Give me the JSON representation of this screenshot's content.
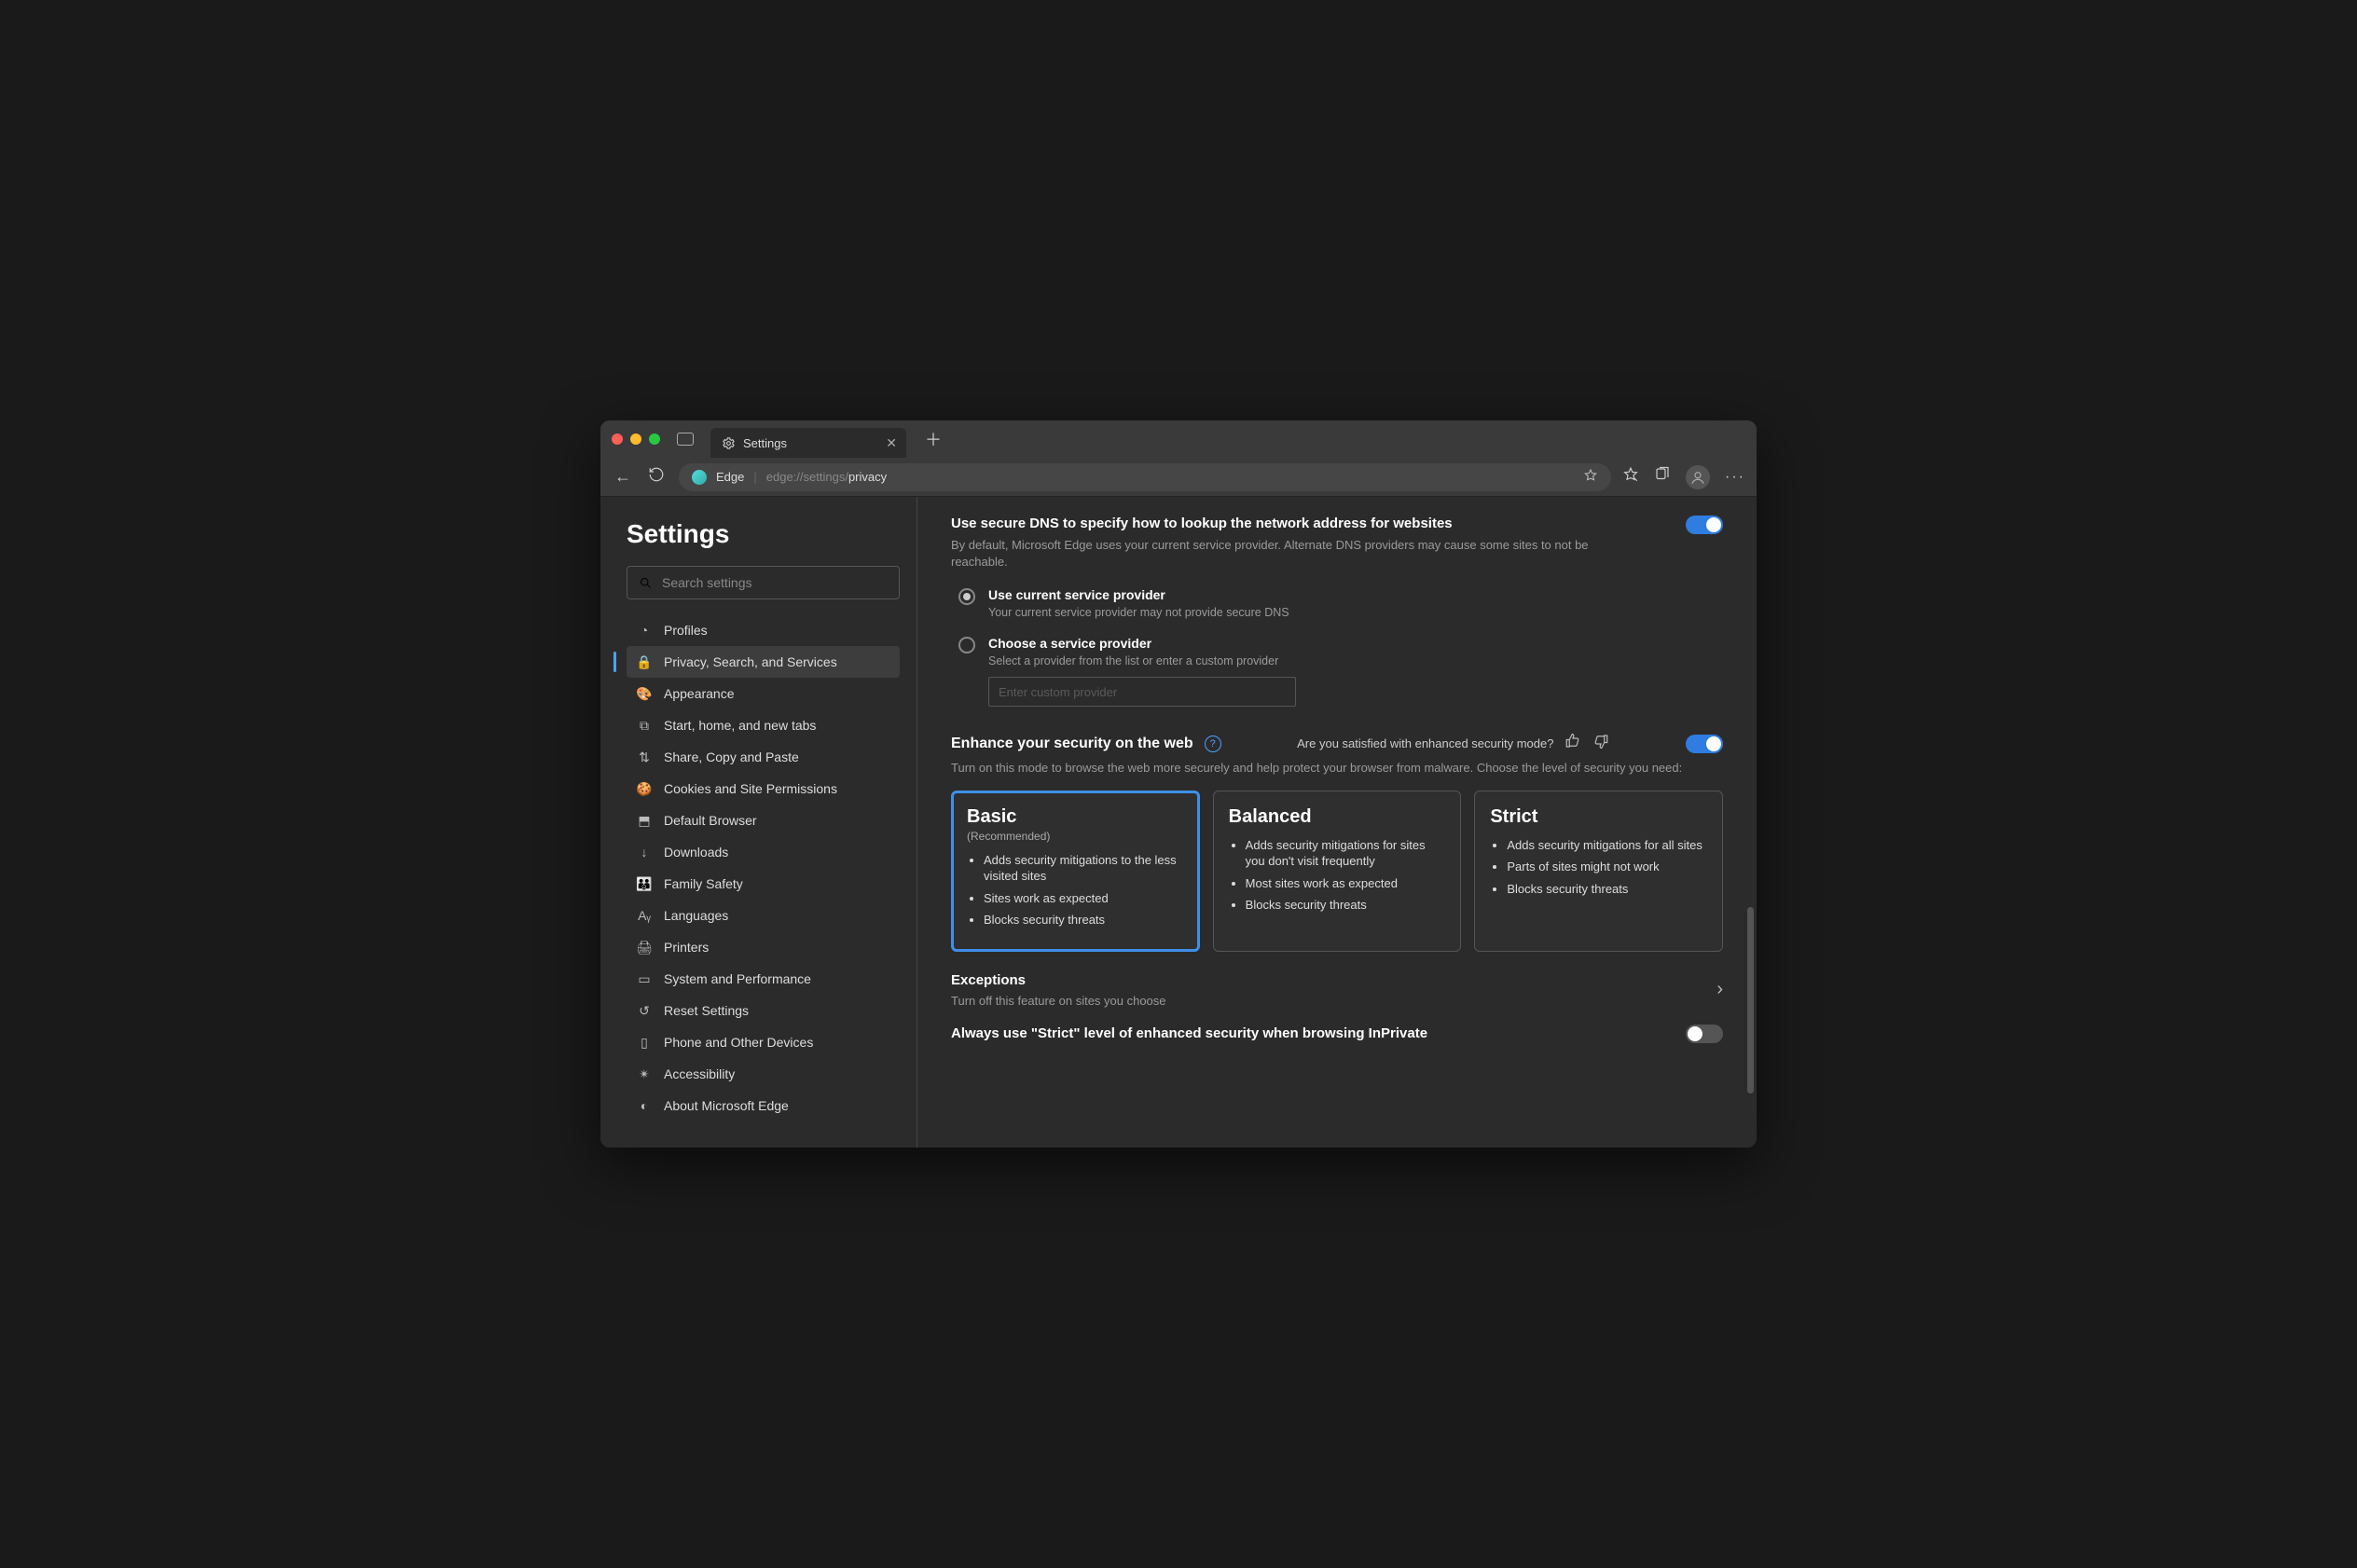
{
  "window": {
    "tab_title": "Settings"
  },
  "omnibox": {
    "label": "Edge",
    "url_dim": "edge://settings/",
    "url_hl": "privacy"
  },
  "sidebar": {
    "title": "Settings",
    "search_placeholder": "Search settings",
    "items": [
      {
        "label": "Profiles"
      },
      {
        "label": "Privacy, Search, and Services"
      },
      {
        "label": "Appearance"
      },
      {
        "label": "Start, home, and new tabs"
      },
      {
        "label": "Share, Copy and Paste"
      },
      {
        "label": "Cookies and Site Permissions"
      },
      {
        "label": "Default Browser"
      },
      {
        "label": "Downloads"
      },
      {
        "label": "Family Safety"
      },
      {
        "label": "Languages"
      },
      {
        "label": "Printers"
      },
      {
        "label": "System and Performance"
      },
      {
        "label": "Reset Settings"
      },
      {
        "label": "Phone and Other Devices"
      },
      {
        "label": "Accessibility"
      },
      {
        "label": "About Microsoft Edge"
      }
    ]
  },
  "dns": {
    "title": "Use secure DNS to specify how to lookup the network address for websites",
    "desc": "By default, Microsoft Edge uses your current service provider. Alternate DNS providers may cause some sites to not be reachable.",
    "opt1_title": "Use current service provider",
    "opt1_desc": "Your current service provider may not provide secure DNS",
    "opt2_title": "Choose a service provider",
    "opt2_desc": "Select a provider from the list or enter a custom provider",
    "custom_placeholder": "Enter custom provider"
  },
  "enhance": {
    "title": "Enhance your security on the web",
    "survey": "Are you satisfied with enhanced security mode?",
    "desc": "Turn on this mode to browse the web more securely and help protect your browser from malware. Choose the level of security you need:",
    "cards": [
      {
        "title": "Basic",
        "rec": "(Recommended)",
        "bullets": [
          "Adds security mitigations to the less visited sites",
          "Sites work as expected",
          "Blocks security threats"
        ]
      },
      {
        "title": "Balanced",
        "rec": "",
        "bullets": [
          "Adds security mitigations for sites you don't visit frequently",
          "Most sites work as expected",
          "Blocks security threats"
        ]
      },
      {
        "title": "Strict",
        "rec": "",
        "bullets": [
          "Adds security mitigations for all sites",
          "Parts of sites might not work",
          "Blocks security threats"
        ]
      }
    ],
    "exceptions_title": "Exceptions",
    "exceptions_desc": "Turn off this feature on sites you choose",
    "always_strict": "Always use \"Strict\" level of enhanced security when browsing InPrivate"
  }
}
